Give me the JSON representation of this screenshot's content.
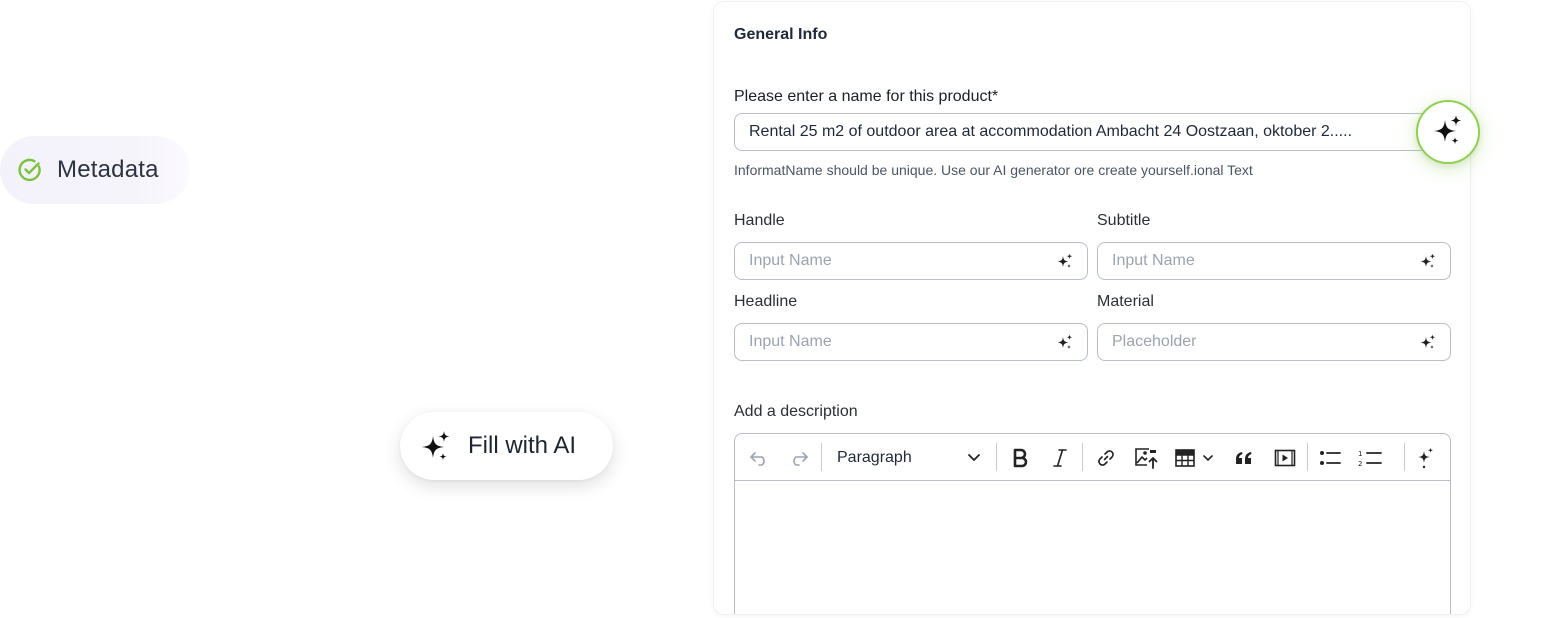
{
  "metadata": {
    "label": "Metadata",
    "accent": "#7cc242"
  },
  "fill_ai": {
    "label": "Fill with AI"
  },
  "card": {
    "title": "General Info",
    "name_field": {
      "label": "Please enter a name for this product*",
      "value": "Rental 25 m2 of outdoor area at accommodation Ambacht 24 Oostzaan, oktober 2.....",
      "helper": "InformatName should be unique. Use our AI generator ore create yourself.ional Text"
    },
    "handle": {
      "label": "Handle",
      "placeholder": "Input Name"
    },
    "subtitle": {
      "label": "Subtitle",
      "placeholder": "Input Name"
    },
    "headline": {
      "label": "Headline",
      "placeholder": "Input Name"
    },
    "material": {
      "label": "Material",
      "placeholder": "Placeholder"
    },
    "description": {
      "label": "Add a description",
      "toolbar": {
        "block_format": "Paragraph"
      }
    }
  },
  "icons": {
    "metadata_status": "check-circle-icon",
    "fill_ai": "sparkles-icon",
    "ai_generate": "sparkles-icon",
    "field_ai": "sparkles-icon",
    "undo": "undo-icon",
    "redo": "redo-icon",
    "bold": "bold-icon",
    "italic": "italic-icon",
    "link": "link-icon",
    "image": "image-upload-icon",
    "table": "table-icon",
    "quote": "quote-icon",
    "media": "media-icon",
    "bullet_list": "bullet-list-icon",
    "numbered_list": "numbered-list-icon"
  },
  "colors": {
    "ai_ring": "#8fd14f",
    "border": "#b9bec6",
    "pill_bg": "#f3f1fa"
  }
}
